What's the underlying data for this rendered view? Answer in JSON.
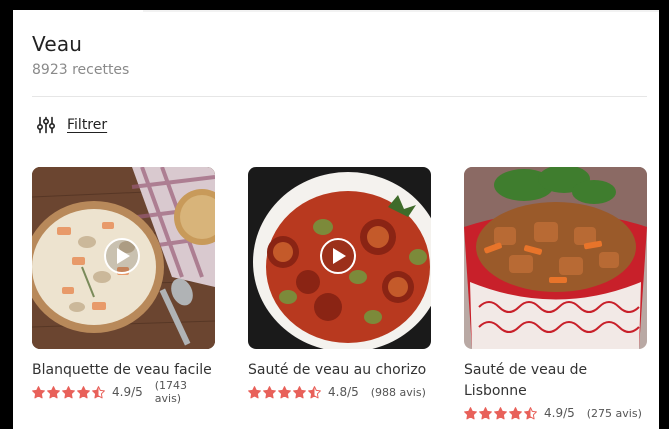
{
  "header": {
    "title": "Veau",
    "count_label": "8923 recettes"
  },
  "filter": {
    "label": "Filtrer",
    "icon": "sliders-icon"
  },
  "colors": {
    "star": "#e8615a",
    "title": "#222222",
    "muted": "#8a8a8a"
  },
  "recipes": [
    {
      "title": "Blanquette de veau facile",
      "rating": 4.5,
      "rating_label": "4.9/5",
      "reviews_label": "(1743 avis)",
      "has_video": true
    },
    {
      "title": "Sauté de veau au chorizo",
      "rating": 4.5,
      "rating_label": "4.8/5",
      "reviews_label": "(988 avis)",
      "has_video": true
    },
    {
      "title": "Sauté de veau de Lisbonne",
      "rating": 4.5,
      "rating_label": "4.9/5",
      "reviews_label": "(275 avis)",
      "has_video": false
    }
  ]
}
